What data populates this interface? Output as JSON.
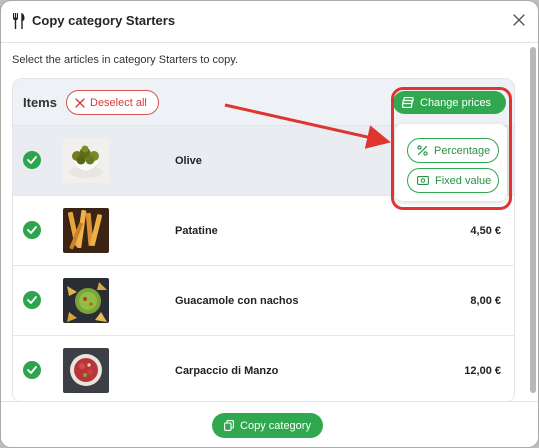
{
  "dialog": {
    "title": "Copy category Starters",
    "instruction": "Select the articles in category Starters to copy."
  },
  "panel": {
    "items_label": "Items",
    "deselect_label": "Deselect all",
    "change_prices_label": "Change prices"
  },
  "popup": {
    "percentage_label": "Percentage",
    "fixed_value_label": "Fixed value"
  },
  "items": [
    {
      "name": "Olive",
      "price": "",
      "selected_row": true
    },
    {
      "name": "Patatine",
      "price": "4,50 €"
    },
    {
      "name": "Guacamole con nachos",
      "price": "8,00 €"
    },
    {
      "name": "Carpaccio di Manzo",
      "price": "12,00 €"
    }
  ],
  "footer": {
    "copy_label": "Copy category"
  },
  "colors": {
    "primary_green": "#30a84f",
    "danger_red": "#d23c38",
    "annotation_red": "#e0342e"
  },
  "icons": [
    "fork-knife-icon",
    "close-icon",
    "x-icon",
    "money-stack-icon",
    "percent-icon",
    "banknote-icon",
    "check-icon",
    "copy-icon"
  ]
}
